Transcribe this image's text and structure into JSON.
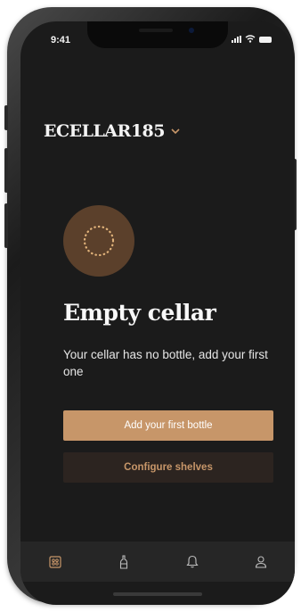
{
  "status_bar": {
    "time": "9:41"
  },
  "header": {
    "cellar_name": "ECELLAR185"
  },
  "empty_state": {
    "title": "Empty cellar",
    "message": "Your cellar has no bottle, add your first one"
  },
  "actions": {
    "primary_label": "Add your first bottle",
    "secondary_label": "Configure shelves"
  },
  "tabbar": {
    "items": [
      {
        "icon": "cellar-grid-icon",
        "active": true
      },
      {
        "icon": "bottle-icon",
        "active": false
      },
      {
        "icon": "bell-icon",
        "active": false
      },
      {
        "icon": "user-icon",
        "active": false
      }
    ]
  },
  "colors": {
    "accent": "#c79669",
    "background": "#1b1b1b",
    "icon_circle": "#5b402b",
    "tabbar": "#262626"
  }
}
